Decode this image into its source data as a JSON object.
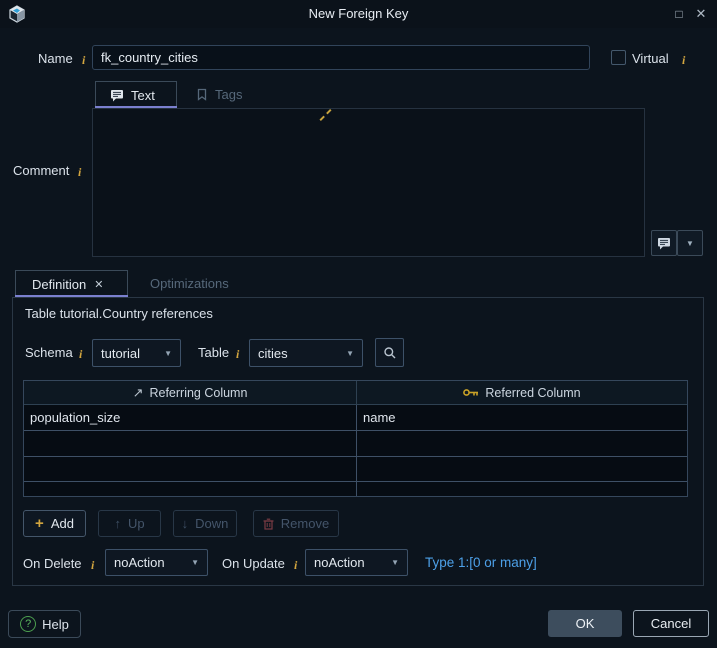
{
  "window": {
    "title": "New Foreign Key",
    "controls": {
      "maximize": "□",
      "close": "✕"
    }
  },
  "glyphs": {
    "dropdown": "▼",
    "referring_arrow": "↗"
  },
  "form": {
    "name": {
      "label": "Name",
      "info": "i",
      "value": "fk_country_cities"
    },
    "virtual": {
      "label": "Virtual",
      "info": "i",
      "checked": false
    },
    "comment": {
      "label": "Comment",
      "info": "i",
      "value": "",
      "tabs": {
        "text": "Text",
        "tags": "Tags"
      }
    }
  },
  "tabs": {
    "definition": "Definition",
    "definition_close": "✕",
    "optimizations": "Optimizations"
  },
  "definition": {
    "reference_line": "Table tutorial.Country references",
    "schema": {
      "label": "Schema",
      "info": "i",
      "value": "tutorial"
    },
    "table": {
      "label": "Table",
      "info": "i",
      "value": "cities"
    },
    "grid": {
      "headers": {
        "referring": "Referring Column",
        "referred": "Referred Column"
      },
      "rows": [
        {
          "referring": "population_size",
          "referred": "name"
        },
        {
          "referring": "",
          "referred": ""
        },
        {
          "referring": "",
          "referred": ""
        },
        {
          "referring": "",
          "referred": ""
        }
      ]
    },
    "buttons": {
      "add": "Add",
      "add_icon": "+",
      "up": "Up",
      "up_icon": "↑",
      "down": "Down",
      "down_icon": "↓",
      "remove": "Remove"
    },
    "rules": {
      "on_delete": {
        "label": "On Delete",
        "info": "i",
        "value": "noAction"
      },
      "on_update": {
        "label": "On Update",
        "info": "i",
        "value": "noAction"
      },
      "type_hint": "Type 1:[0 or many]"
    }
  },
  "footer": {
    "help": "Help",
    "help_icon": "?",
    "ok": "OK",
    "cancel": "Cancel"
  },
  "colors": {
    "background": "#0c141d",
    "accent_gold": "#d2a53f",
    "link_blue": "#4da0e8",
    "tab_underline": "#7b80cf",
    "key_gold": "#c9a227",
    "ok_button": "#3d4d5d"
  }
}
